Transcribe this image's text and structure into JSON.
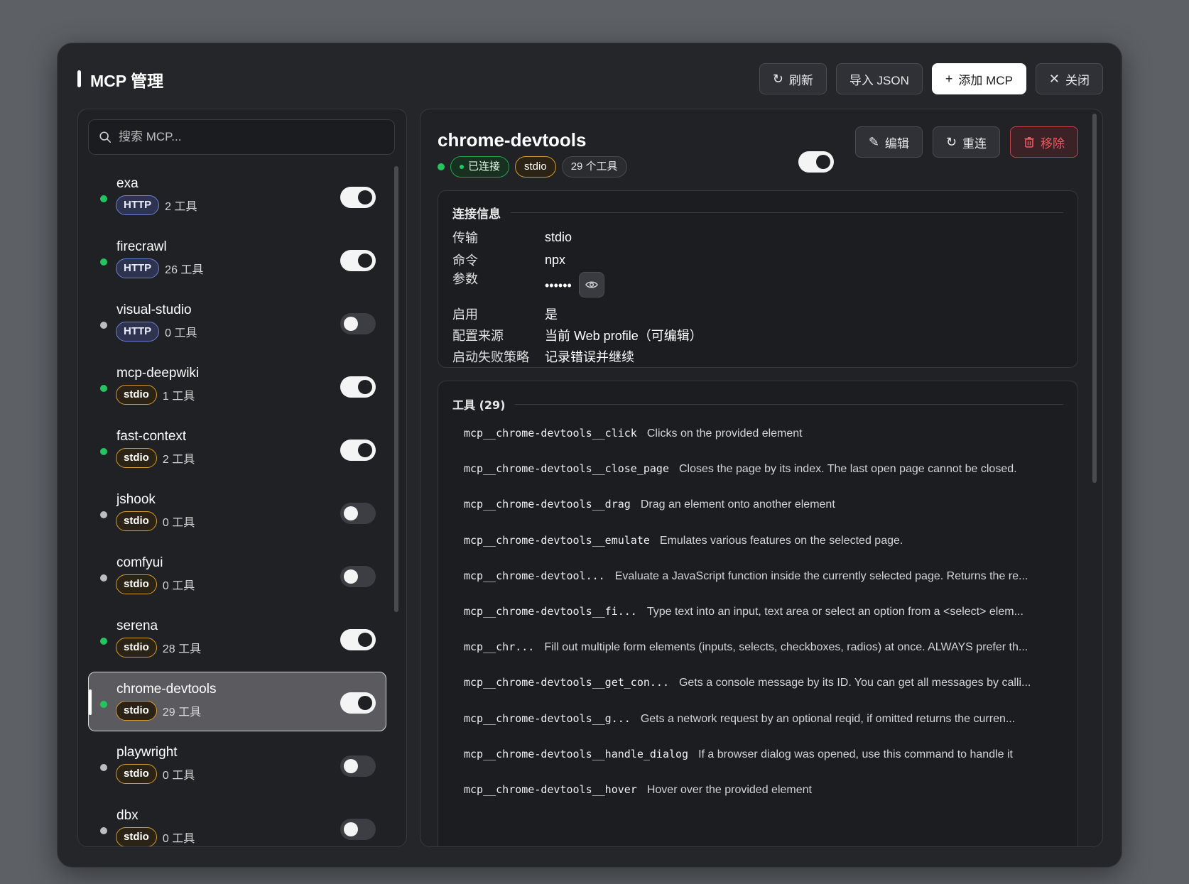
{
  "header": {
    "title": "MCP 管理",
    "refresh": "刷新",
    "import": "导入 JSON",
    "add": "添加 MCP",
    "close": "关闭"
  },
  "search": {
    "placeholder": "搜索 MCP..."
  },
  "mcps": [
    {
      "name": "exa",
      "transport": "HTTP",
      "tools": "2 工具",
      "connected": true,
      "enabled": true
    },
    {
      "name": "firecrawl",
      "transport": "HTTP",
      "tools": "26 工具",
      "connected": true,
      "enabled": true
    },
    {
      "name": "visual-studio",
      "transport": "HTTP",
      "tools": "0 工具",
      "connected": false,
      "enabled": false
    },
    {
      "name": "mcp-deepwiki",
      "transport": "stdio",
      "tools": "1 工具",
      "connected": true,
      "enabled": true
    },
    {
      "name": "fast-context",
      "transport": "stdio",
      "tools": "2 工具",
      "connected": true,
      "enabled": true
    },
    {
      "name": "jshook",
      "transport": "stdio",
      "tools": "0 工具",
      "connected": false,
      "enabled": false
    },
    {
      "name": "comfyui",
      "transport": "stdio",
      "tools": "0 工具",
      "connected": false,
      "enabled": false
    },
    {
      "name": "serena",
      "transport": "stdio",
      "tools": "28 工具",
      "connected": true,
      "enabled": true
    },
    {
      "name": "chrome-devtools",
      "transport": "stdio",
      "tools": "29 工具",
      "connected": true,
      "enabled": true
    },
    {
      "name": "playwright",
      "transport": "stdio",
      "tools": "0 工具",
      "connected": false,
      "enabled": false
    },
    {
      "name": "dbx",
      "transport": "stdio",
      "tools": "0 工具",
      "connected": false,
      "enabled": false
    }
  ],
  "selected_index": 8,
  "detail": {
    "name": "chrome-devtools",
    "status": "已连接",
    "transport": "stdio",
    "tools_count": "29 个工具",
    "edit": "编辑",
    "reconnect": "重连",
    "remove": "移除",
    "enabled": true
  },
  "connection": {
    "title": "连接信息",
    "rows": [
      {
        "k": "传输",
        "v": "stdio"
      },
      {
        "k": "命令",
        "v": "npx"
      },
      {
        "k": "参数",
        "v": "••••••"
      },
      {
        "k": "启用",
        "v": "是"
      },
      {
        "k": "配置来源",
        "v": "当前 Web profile（可编辑）"
      },
      {
        "k": "启动失败策略",
        "v": "记录错误并继续"
      }
    ]
  },
  "tools": {
    "title": "工具 (29)",
    "items": [
      {
        "name": "mcp__chrome-devtools__click",
        "desc": "Clicks on the provided element"
      },
      {
        "name": "mcp__chrome-devtools__close_page",
        "desc": "Closes the page by its index. The last open page cannot be closed."
      },
      {
        "name": "mcp__chrome-devtools__drag",
        "desc": "Drag an element onto another element"
      },
      {
        "name": "mcp__chrome-devtools__emulate",
        "desc": "Emulates various features on the selected page."
      },
      {
        "name": "mcp__chrome-devtool...",
        "desc": "Evaluate a JavaScript function inside the currently selected page. Returns the re..."
      },
      {
        "name": "mcp__chrome-devtools__fi...",
        "desc": "Type text into an input, text area or select an option from a <select> elem..."
      },
      {
        "name": "mcp__chr...",
        "desc": "Fill out multiple form elements (inputs, selects, checkboxes, radios) at once. ALWAYS prefer th..."
      },
      {
        "name": "mcp__chrome-devtools__get_con...",
        "desc": "Gets a console message by its ID. You can get all messages by calli..."
      },
      {
        "name": "mcp__chrome-devtools__g...",
        "desc": "Gets a network request by an optional reqid, if omitted returns the curren..."
      },
      {
        "name": "mcp__chrome-devtools__handle_dialog",
        "desc": "If a browser dialog was opened, use this command to handle it"
      },
      {
        "name": "mcp__chrome-devtools__hover",
        "desc": "Hover over the provided element"
      }
    ]
  },
  "colors": {
    "connected": "#22c55e",
    "http_badge": "#6b7fd4",
    "stdio_badge": "#d69a2d",
    "danger": "#ef5a62"
  }
}
